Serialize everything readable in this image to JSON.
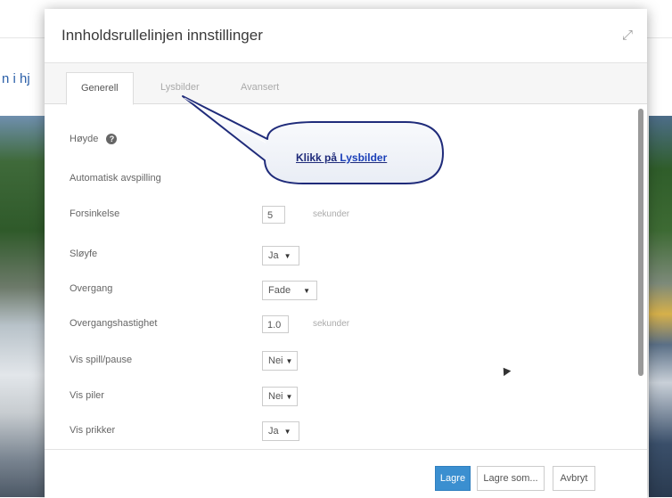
{
  "background": {
    "heading_fragment": "n i hj"
  },
  "dialog": {
    "title": "Innholdsrullelinjen innstillinger",
    "tabs": [
      {
        "label": "Generell",
        "active": true
      },
      {
        "label": "Lysbilder",
        "active": false
      },
      {
        "label": "Avansert",
        "active": false
      }
    ],
    "fields": {
      "height": {
        "label": "Høyde"
      },
      "autoplay": {
        "label": "Automatisk avspilling"
      },
      "delay": {
        "label": "Forsinkelse",
        "value": "5",
        "unit": "sekunder"
      },
      "loop": {
        "label": "Sløyfe",
        "value": "Ja"
      },
      "transition": {
        "label": "Overgang",
        "value": "Fade"
      },
      "transition_speed": {
        "label": "Overgangshastighet",
        "value": "1.0",
        "unit": "sekunder"
      },
      "show_play_pause": {
        "label": "Vis spill/pause",
        "value": "Nei"
      },
      "show_arrows": {
        "label": "Vis piler",
        "value": "Nei"
      },
      "show_dots": {
        "label": "Vis prikker",
        "value": "Ja"
      }
    },
    "buttons": {
      "save": "Lagre",
      "save_as": "Lagre som...",
      "cancel": "Avbryt"
    }
  },
  "callout": {
    "prefix": "Klikk på ",
    "link": "Lysbilder"
  },
  "colors": {
    "primary_button": "#3b8fd0",
    "callout_text": "#1f2b7a"
  }
}
